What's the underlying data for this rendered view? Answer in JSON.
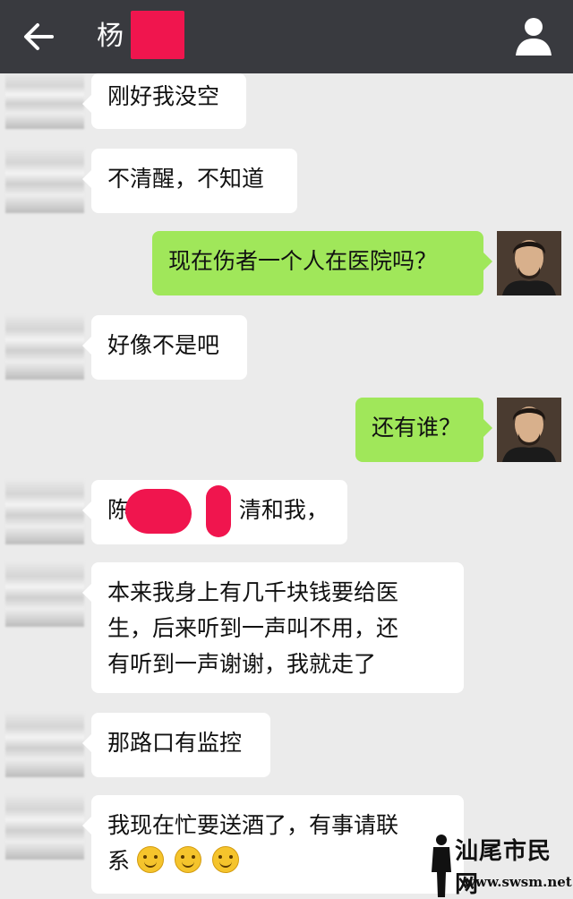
{
  "header": {
    "title": "杨",
    "back_icon": "arrow-left-icon",
    "profile_icon": "person-icon",
    "background": "#393a3f"
  },
  "messages": [
    {
      "side": "left",
      "text": "刚好我没空"
    },
    {
      "side": "left",
      "text": "不清醒，不知道"
    },
    {
      "side": "right",
      "text": "现在伤者一个人在医院吗？"
    },
    {
      "side": "left",
      "text": "好像不是吧"
    },
    {
      "side": "right",
      "text": "还有谁？"
    },
    {
      "side": "left",
      "text_start": "陈",
      "text_end": "清和我，"
    },
    {
      "side": "left",
      "lines": [
        "本来我身上有几千块钱要给医",
        "生，后来听到一声叫不用，还",
        "有听到一声谢谢，我就走了"
      ]
    },
    {
      "side": "left",
      "text": "那路口有监控"
    },
    {
      "side": "left",
      "lines": [
        "我现在忙要送酒了，有事请联",
        "系"
      ]
    }
  ],
  "colors": {
    "incoming_bubble": "#ffffff",
    "outgoing_bubble": "#a0e75a",
    "chat_background": "#ebebeb",
    "redaction": "#f0154e"
  },
  "watermark": {
    "title": "汕尾市民网",
    "url": "www.swsm.net"
  }
}
